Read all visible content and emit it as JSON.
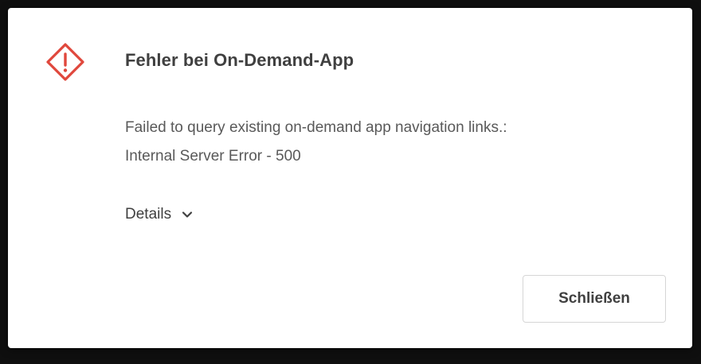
{
  "dialog": {
    "title": "Fehler bei On-Demand-App",
    "message_lines": [
      "Failed to query existing on-demand app navigation links.:",
      "Internal Server Error - 500"
    ],
    "details_label": "Details",
    "close_label": "Schließen"
  },
  "colors": {
    "warning": "#e0473c",
    "text_dark": "#404040",
    "text_body": "#595959",
    "button_border": "#d6d6d6",
    "backdrop": "#0f0f0f"
  },
  "icons": {
    "warning": "warning-diamond-icon",
    "details": "chevron-down-icon"
  }
}
